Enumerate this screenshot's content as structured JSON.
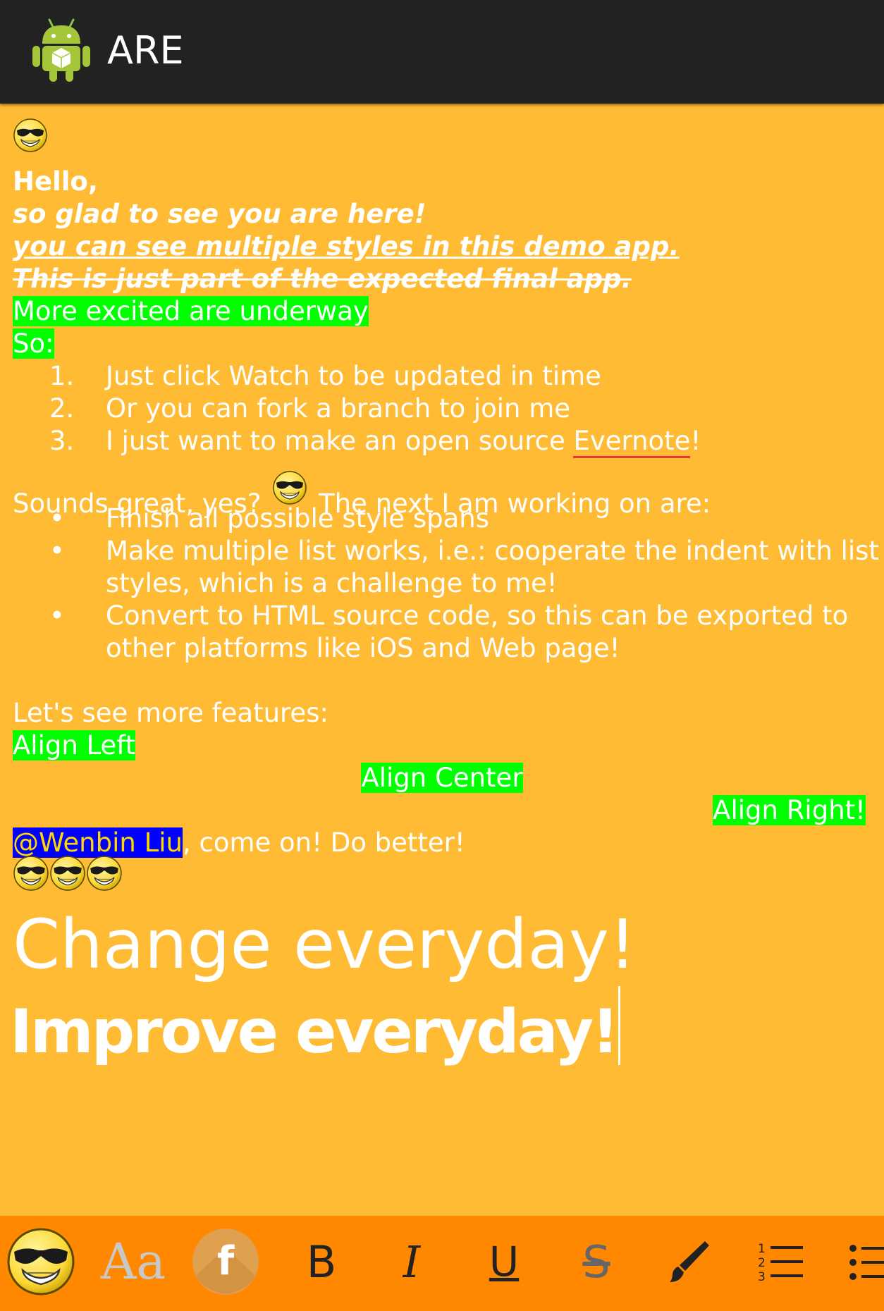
{
  "app": {
    "title": "ARE"
  },
  "editor": {
    "hello": "Hello,",
    "glad": "so glad to see you are here!",
    "multiple": "you can see multiple styles in this demo app.",
    "expected": "This is just part of the expected final app.",
    "excited": "More excited are underway",
    "so": "So:",
    "numbered": [
      {
        "num": "1.",
        "text": "Just click Watch to be updated in time"
      },
      {
        "num": "2.",
        "text": "Or you can fork a branch to join me"
      },
      {
        "num": "3.",
        "text_before": "I just want to make an open source ",
        "link": "Evernote",
        "text_after": "!"
      }
    ],
    "sounds_before": "Sounds great, yes?",
    "sounds_after": "The next I am working on are:",
    "bullets": [
      {
        "lines": [
          "Finish all possible style spans"
        ]
      },
      {
        "lines": [
          "Make multiple list works, i.e.: cooperate the indent with list",
          "styles, which is a challenge to me!"
        ]
      },
      {
        "lines": [
          "Convert to HTML source code, so this can be exported to",
          "other platforms like iOS and Web page!"
        ]
      }
    ],
    "bullet_char": "•",
    "features": "Let's see more features:",
    "align_left": "Align Left",
    "align_center": "Align Center",
    "align_right": "Align Right!",
    "mention": "@Wenbin Liu",
    "mention_after": ", come on! Do better!",
    "change": "Change everyday!",
    "improve": "Improve everyday!"
  },
  "colors": {
    "background": "#FFBB33",
    "appbar": "#222222",
    "toolbar": "#FF8800",
    "highlight": "#00FF00",
    "mention_bg": "#0000FF",
    "mention_fg": "#FFD700",
    "link_underline": "#E53935"
  },
  "toolbar": {
    "items": [
      {
        "icon": "emoji-icon"
      },
      {
        "icon": "font-size-icon",
        "label": "Aa"
      },
      {
        "icon": "font-family-icon",
        "label": "f"
      },
      {
        "icon": "bold-icon",
        "label": "B"
      },
      {
        "icon": "italic-icon",
        "label": "I"
      },
      {
        "icon": "underline-icon",
        "label": "U"
      },
      {
        "icon": "strikethrough-icon",
        "label": "S"
      },
      {
        "icon": "brush-icon"
      },
      {
        "icon": "numbered-list-icon"
      },
      {
        "icon": "bulleted-list-icon"
      }
    ]
  }
}
